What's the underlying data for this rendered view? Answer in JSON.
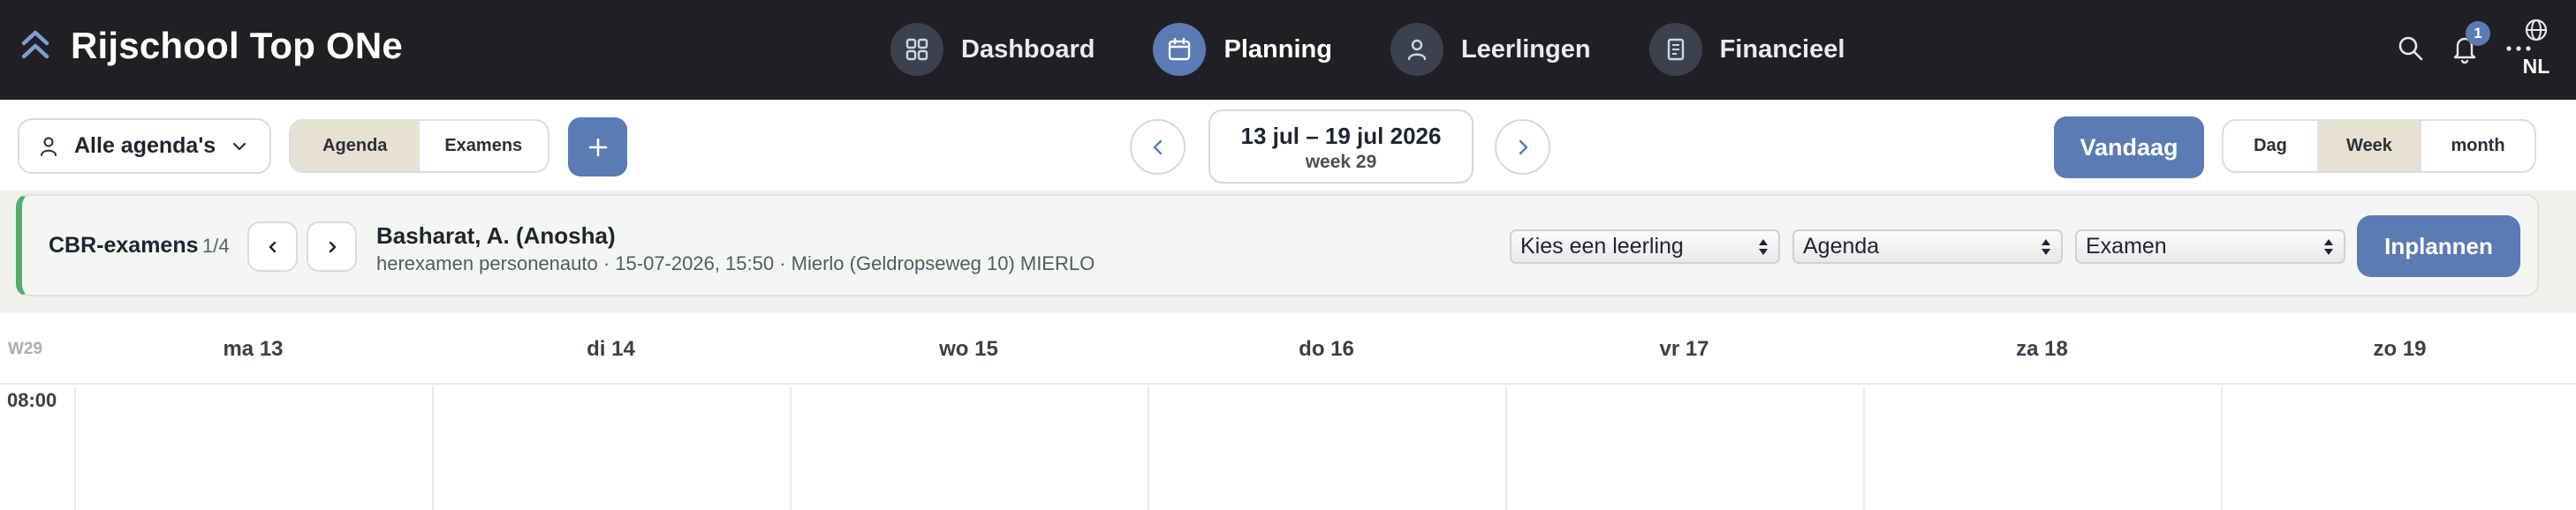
{
  "app": {
    "title": "Rijschool Top ONe"
  },
  "nav": {
    "items": [
      {
        "label": "Dashboard",
        "icon": "grid-icon",
        "active": false
      },
      {
        "label": "Planning",
        "icon": "calendar-icon",
        "active": true
      },
      {
        "label": "Leerlingen",
        "icon": "user-icon",
        "active": false
      },
      {
        "label": "Financieel",
        "icon": "document-icon",
        "active": false
      }
    ]
  },
  "top_actions": {
    "notification_count": "1",
    "language": "NL"
  },
  "toolbar": {
    "agenda_select": "Alle agenda's",
    "view_tabs": [
      {
        "label": "Agenda",
        "active": true
      },
      {
        "label": "Examens",
        "active": false
      }
    ],
    "date_range": "13 jul – 19 jul 2026",
    "week_label": "week 29",
    "today_label": "Vandaag",
    "period_tabs": [
      {
        "label": "Dag",
        "active": false
      },
      {
        "label": "Week",
        "active": true
      },
      {
        "label": "month",
        "active": false
      }
    ]
  },
  "exam_panel": {
    "title": "CBR-examens",
    "count": "1/4",
    "student_name": "Basharat, A. (Anosha)",
    "details": "herexamen personenauto · 15-07-2026, 15:50 · Mierlo (Geldropseweg 10) MIERLO",
    "student_select": "Kies een leerling",
    "agenda_select": "Agenda",
    "exam_select": "Examen",
    "plan_button": "Inplannen"
  },
  "calendar": {
    "week_number": "W29",
    "days": [
      "ma 13",
      "di 14",
      "wo 15",
      "do 16",
      "vr 17",
      "za 18",
      "zo 19"
    ],
    "first_time": "08:00"
  },
  "colors": {
    "nav_background": "#202024",
    "accent": "#5b7bb4",
    "active_segment": "#e7e1d4",
    "exam_border": "#4fae6d"
  }
}
